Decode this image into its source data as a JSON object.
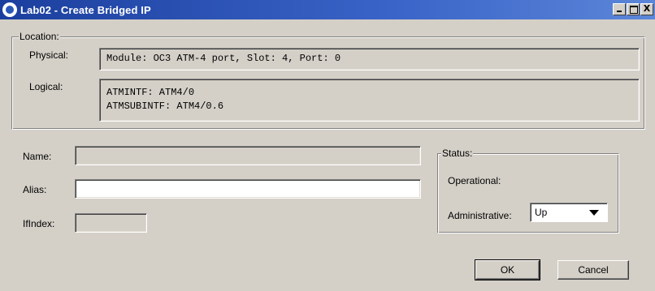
{
  "window": {
    "title": "Lab02 - Create Bridged IP",
    "controls": {
      "minimize": "_",
      "maximize": "□",
      "close": "X"
    }
  },
  "location": {
    "legend": "Location:",
    "physical_label": "Physical:",
    "physical_value": "Module: OC3 ATM-4 port, Slot: 4, Port: 0",
    "logical_label": "Logical:",
    "logical_line1": "ATMINTF: ATM4/0",
    "logical_line2": "ATMSUBINTF: ATM4/0.6"
  },
  "form": {
    "name_label": "Name:",
    "name_value": "",
    "alias_label": "Alias:",
    "alias_value": "",
    "ifindex_label": "IfIndex:",
    "ifindex_value": ""
  },
  "status": {
    "legend": "Status:",
    "operational_label": "Operational:",
    "administrative_label": "Administrative:",
    "administrative_value": "Up"
  },
  "buttons": {
    "ok_label": "OK",
    "cancel_label": "Cancel"
  },
  "colors": {
    "titlebar": "#1b3f9e",
    "dialog_bg": "#d4d0c8"
  }
}
